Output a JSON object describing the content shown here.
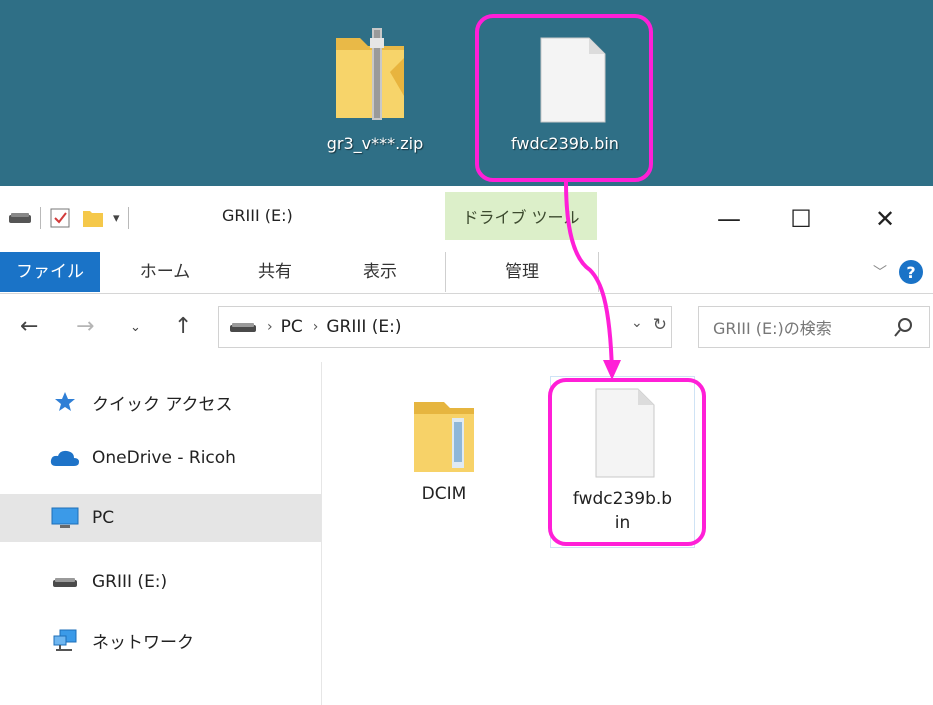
{
  "desktop": {
    "zip_label": "gr3_v***.zip",
    "bin_label": "fwdc239b.bin"
  },
  "window": {
    "title": "GRIII (E:)",
    "context_tab": "ドライブ ツール",
    "controls": {
      "minimize": "—",
      "maximize": "☐",
      "close": "✕"
    },
    "tabs": [
      {
        "label": "ファイル"
      },
      {
        "label": "ホーム"
      },
      {
        "label": "共有"
      },
      {
        "label": "表示"
      },
      {
        "label": "管理"
      }
    ],
    "help": "?"
  },
  "address": {
    "crumbs": [
      "PC",
      "GRIII (E:)"
    ],
    "search_placeholder": "GRIII (E:)の検索"
  },
  "nav": {
    "items": [
      {
        "label": "クイック アクセス",
        "icon": "star-icon"
      },
      {
        "label": "OneDrive - Ricoh",
        "icon": "cloud-icon"
      },
      {
        "label": "PC",
        "icon": "monitor-icon",
        "selected": true
      },
      {
        "label": "GRIII (E:)",
        "icon": "drive-icon"
      },
      {
        "label": "ネットワーク",
        "icon": "network-icon"
      }
    ]
  },
  "files": [
    {
      "name": "DCIM",
      "type": "folder"
    },
    {
      "name_line1": "fwdc239b.b",
      "name_line2": "in",
      "type": "file"
    }
  ],
  "colors": {
    "desktop_bg": "#2f6f86",
    "highlight": "#ff1fd7",
    "file_tab": "#1a73c7",
    "drive_tools": "#dcefc9"
  }
}
